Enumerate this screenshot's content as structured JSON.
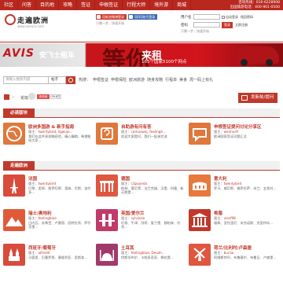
{
  "topnav": {
    "items": [
      "社区",
      "问答",
      "目的地",
      "攻略",
      "签证",
      "申根签证",
      "行程大师",
      "境外游",
      "商城"
    ],
    "phone1": "咨询热线：010-6228908",
    "phone2": "出国旅游电话：400-901-0500"
  },
  "header": {
    "logo_name": "走遍欧洲",
    "logo_url": "www.zoeuro.com",
    "weibo_btn": "用新浪微博登录",
    "qq_btn": "用QQ账号登录",
    "login_hint": "只需一步，快速开始",
    "username_label": "用户名",
    "password_label": "密码",
    "remember": "自动登录",
    "forgot": "找回密码",
    "register": "立即注册",
    "login_btn": "登录",
    "quick_hint": "只需一步，快速开始"
  },
  "banner": {
    "brand": "AVIS",
    "brand_cn": "安飞士租车",
    "big_char": "等你",
    "headline": "来租",
    "subline": "165个国家5100个网点"
  },
  "search": {
    "placeholder": "请输入搜索内容",
    "scope": "帖子",
    "hot_label": "热搜：",
    "hot_terms": [
      "申根签证",
      "申根保险",
      "欧洲旅游",
      "随身攻略",
      "行程单",
      "美食",
      "周一码上有礼"
    ]
  },
  "breadcrumb": {
    "sep": "›",
    "current": "论坛",
    "weibo": "收听我",
    "count": "39.6万"
  },
  "newpost": "发新帖/提问",
  "sections": {
    "must_read": "必读版块",
    "walk_europe": "走遍欧洲"
  },
  "must_cards": [
    {
      "title": "欧洲多国游 & 新手指南",
      "owner_label": "版主：",
      "owner": "twentybird, llgwujo...",
      "desc": "我们在此共享攻略经验，精心编辑，希望能给大家..."
    },
    {
      "title": "自助游有问有答",
      "owner_label": "版主：",
      "owner": "camuswej, feelingh...",
      "desc": "欢迎大家提问，我们一起来交流"
    },
    {
      "title": "申根签证提问讨论分享区",
      "owner_label": "版主：",
      "owner": "weimur9",
      "desc": "欧洲国家签证问题汇总"
    }
  ],
  "walk_cards": [
    {
      "title": "法国",
      "owner_label": "版主：",
      "owner": "twentybird",
      "desc": "巴黎、里昂、普罗旺斯、戛纳、尼斯、波尔多...",
      "icon": "eiffel-icon",
      "color": "#d94b3a"
    },
    {
      "title": "德国",
      "owner_label": "版主：",
      "owner": "c3poyeda",
      "desc": "柏林、慕尼黑、法兰克福、汉堡、科隆、新天鹅堡...",
      "icon": "gate-icon",
      "color": "#e0563f"
    },
    {
      "title": "意大利",
      "owner_label": "版主：",
      "owner": "twentybird",
      "desc": "罗马、威尼斯、佛罗伦萨、米兰、五渔村...",
      "icon": "colosseum-icon",
      "color": "#e8783c"
    },
    {
      "title": "瑞士/奥地利",
      "owner_label": "版主：",
      "owner": "feelingblue",
      "desc": "日内瓦、苏黎世、卢塞恩、因特拉肯、萨尔茨堡...",
      "icon": "alps-icon",
      "color": "#e05a3a"
    },
    {
      "title": "英国/爱尔兰",
      "owner_label": "版主：",
      "owner": "sylvizzie",
      "desc": "伦敦、牛津、剑桥、爱丁堡、都柏林、约克...",
      "icon": "bridge-icon",
      "color": "#c23a6a"
    },
    {
      "title": "希腊",
      "owner_label": "版主：",
      "owner": "xiesf98",
      "desc": "雅典、圣托里尼、米克诺斯、克里特岛...",
      "icon": "temple-icon",
      "color": "#c0392b"
    },
    {
      "title": "西班牙/葡萄牙",
      "owner_label": "版主：",
      "owner": "alfredd",
      "desc": "马德里、巴塞罗那、塞维利亚、里斯本...",
      "icon": "cathedral-icon",
      "color": "#d94b3a"
    },
    {
      "title": "土耳其",
      "owner_label": "版主：",
      "owner": "feelingblue, Deuzh...",
      "desc": "伊斯坦布尔、卡帕多奇亚、棉花堡...",
      "icon": "mosque-icon",
      "color": "#a13a6a"
    },
    {
      "title": "荷兰/比利时/卢森堡",
      "owner_label": "版主：",
      "owner": "bucao",
      "desc": "阿姆斯特丹、布鲁塞尔、布鲁日、卢森堡...",
      "icon": "windmill-icon",
      "color": "#e0563f"
    }
  ]
}
